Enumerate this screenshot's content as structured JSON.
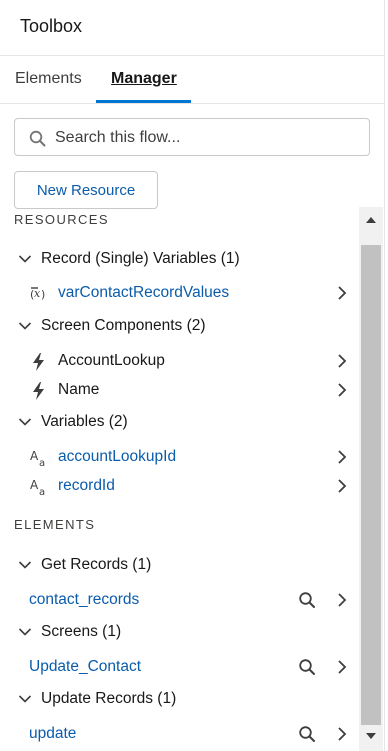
{
  "header": {
    "title": "Toolbox"
  },
  "tabs": [
    {
      "label": "Elements"
    },
    {
      "label": "Manager"
    }
  ],
  "search": {
    "placeholder": "Search this flow..."
  },
  "new_resource_label": "New Resource",
  "resources": {
    "heading": "RESOURCES",
    "groups": [
      {
        "label": "Record (Single) Variables (1)",
        "items": [
          {
            "label": "varContactRecordValues",
            "icon": "record-variable-icon"
          }
        ]
      },
      {
        "label": "Screen Components (2)",
        "items": [
          {
            "label": "AccountLookup",
            "icon": "lightning-bolt-icon"
          },
          {
            "label": "Name",
            "icon": "lightning-bolt-icon"
          }
        ]
      },
      {
        "label": "Variables (2)",
        "items": [
          {
            "label": "accountLookupId",
            "icon": "text-variable-icon"
          },
          {
            "label": "recordId",
            "icon": "text-variable-icon"
          }
        ]
      }
    ]
  },
  "elements": {
    "heading": "ELEMENTS",
    "groups": [
      {
        "label": "Get Records (1)",
        "items": [
          {
            "label": "contact_records"
          }
        ]
      },
      {
        "label": "Screens (1)",
        "items": [
          {
            "label": "Update_Contact"
          }
        ]
      },
      {
        "label": "Update Records (1)",
        "items": [
          {
            "label": "update"
          }
        ]
      }
    ]
  },
  "colors": {
    "accent": "#0176d3",
    "link": "#0b5cab",
    "text": "#181818",
    "border": "#e5e5e5",
    "scrollbar_thumb": "#c1c1c1"
  }
}
